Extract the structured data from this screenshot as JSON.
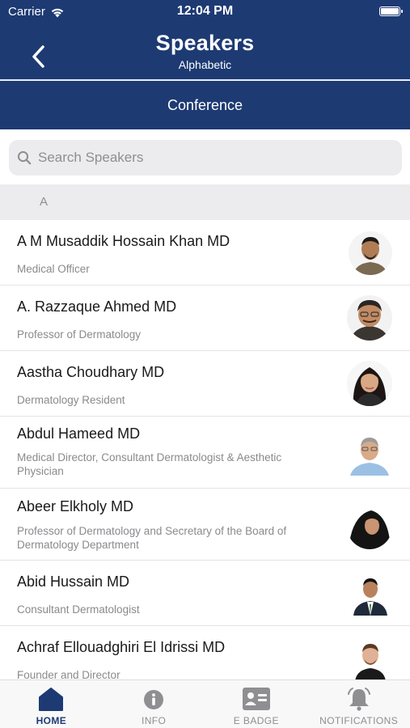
{
  "status_bar": {
    "carrier": "Carrier",
    "time": "12:04 PM"
  },
  "header": {
    "title": "Speakers",
    "subtitle": "Alphabetic",
    "tab": "Conference"
  },
  "search": {
    "placeholder": "Search Speakers",
    "value": ""
  },
  "section": {
    "letter": "A"
  },
  "speakers": [
    {
      "name": "A M Musaddik Hossain Khan MD",
      "role": "Medical Officer"
    },
    {
      "name": "A. Razzaque Ahmed MD",
      "role": "Professor of Dermatology"
    },
    {
      "name": "Aastha Choudhary MD",
      "role": "Dermatology Resident"
    },
    {
      "name": "Abdul Hameed MD",
      "role": "Medical Director, Consultant Dermatologist & Aesthetic Physician"
    },
    {
      "name": "Abeer Elkholy MD",
      "role": "Professor of Dermatology and Secretary of the Board of Dermatology Department"
    },
    {
      "name": "Abid Hussain MD",
      "role": "Consultant Dermatologist"
    },
    {
      "name": "Achraf Ellouadghiri El Idrissi MD",
      "role": "Founder and Director"
    }
  ],
  "tabbar": {
    "home": "HOME",
    "info": "INFO",
    "badge": "E BADGE",
    "notifications": "NOTIFICATIONS"
  },
  "colors": {
    "brand": "#1d3a73",
    "inactive": "#8e8e93"
  },
  "icons": {
    "back": "chevron-left-icon",
    "search": "search-icon",
    "home": "home-icon",
    "info": "info-icon",
    "badge": "badge-card-icon",
    "notifications": "bell-icon"
  }
}
